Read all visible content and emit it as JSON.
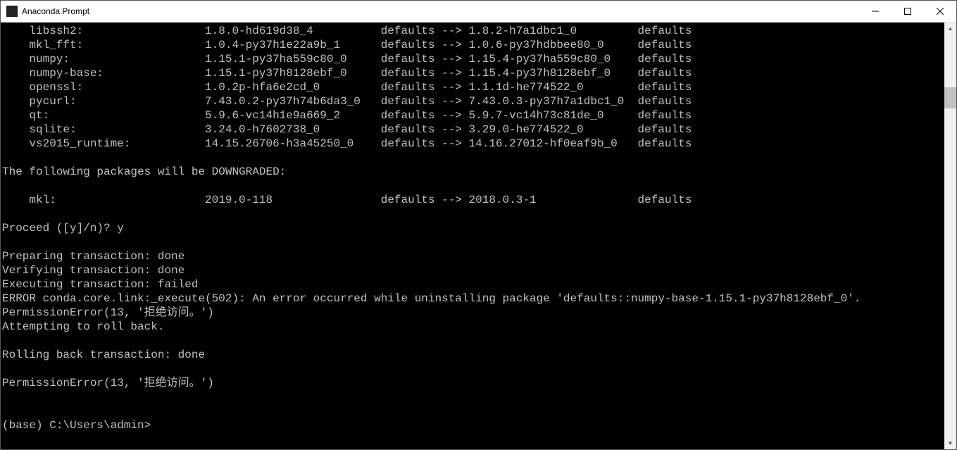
{
  "window": {
    "title": "Anaconda Prompt"
  },
  "upgrades": [
    {
      "name": "libssh2:",
      "ver_from": "1.8.0-hd619d38_4",
      "chan_from": "defaults",
      "ver_to": "1.8.2-h7a1dbc1_0",
      "chan_to": "defaults"
    },
    {
      "name": "mkl_fft:",
      "ver_from": "1.0.4-py37h1e22a9b_1",
      "chan_from": "defaults",
      "ver_to": "1.0.6-py37hdbbee80_0",
      "chan_to": "defaults"
    },
    {
      "name": "numpy:",
      "ver_from": "1.15.1-py37ha559c80_0",
      "chan_from": "defaults",
      "ver_to": "1.15.4-py37ha559c80_0",
      "chan_to": "defaults"
    },
    {
      "name": "numpy-base:",
      "ver_from": "1.15.1-py37h8128ebf_0",
      "chan_from": "defaults",
      "ver_to": "1.15.4-py37h8128ebf_0",
      "chan_to": "defaults"
    },
    {
      "name": "openssl:",
      "ver_from": "1.0.2p-hfa6e2cd_0",
      "chan_from": "defaults",
      "ver_to": "1.1.1d-he774522_0",
      "chan_to": "defaults"
    },
    {
      "name": "pycurl:",
      "ver_from": "7.43.0.2-py37h74b6da3_0",
      "chan_from": "defaults",
      "ver_to": "7.43.0.3-py37h7a1dbc1_0",
      "chan_to": "defaults"
    },
    {
      "name": "qt:",
      "ver_from": "5.9.6-vc14h1e9a669_2",
      "chan_from": "defaults",
      "ver_to": "5.9.7-vc14h73c81de_0",
      "chan_to": "defaults"
    },
    {
      "name": "sqlite:",
      "ver_from": "3.24.0-h7602738_0",
      "chan_from": "defaults",
      "ver_to": "3.29.0-he774522_0",
      "chan_to": "defaults"
    },
    {
      "name": "vs2015_runtime:",
      "ver_from": "14.15.26706-h3a45250_0",
      "chan_from": "defaults",
      "ver_to": "14.16.27012-hf0eaf9b_0",
      "chan_to": "defaults"
    }
  ],
  "downgrade_heading": "The following packages will be DOWNGRADED:",
  "downgrades": [
    {
      "name": "mkl:",
      "ver_from": "2019.0-118",
      "chan_from": "defaults",
      "ver_to": "2018.0.3-1",
      "chan_to": "defaults"
    }
  ],
  "lines": {
    "proceed": "Proceed ([y]/n)? y",
    "prep": "Preparing transaction: done",
    "verify": "Verifying transaction: done",
    "exec": "Executing transaction: failed",
    "err": "ERROR conda.core.link:_execute(502): An error occurred while uninstalling package 'defaults::numpy-base-1.15.1-py37h8128ebf_0'.",
    "perm1": "PermissionError(13, '拒绝访问。')",
    "attempt": "Attempting to roll back.",
    "rollback": "Rolling back transaction: done",
    "perm2": "PermissionError(13, '拒绝访问。')",
    "prompt": "(base) C:\\Users\\admin>"
  }
}
